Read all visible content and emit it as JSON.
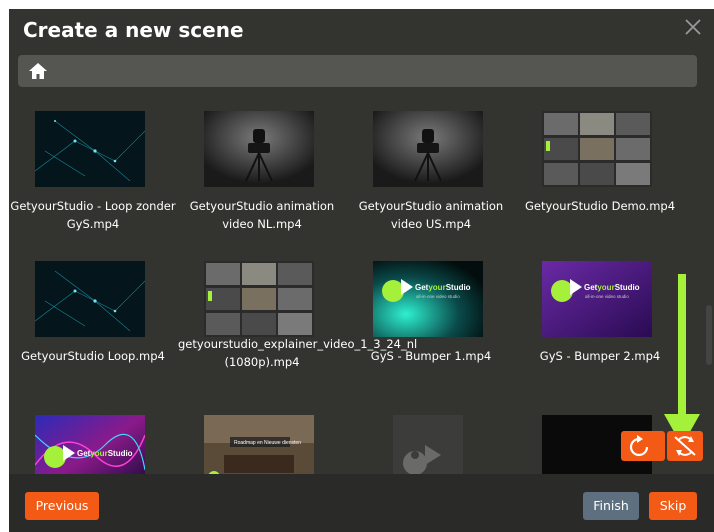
{
  "dialog": {
    "title": "Create a new scene",
    "close_icon": "close-icon",
    "breadcrumb_icon": "home-icon"
  },
  "media": [
    {
      "caption": "GetyourStudio - Loop zonder GyS.mp4",
      "thumb": "network"
    },
    {
      "caption": "GetyourStudio animation video NL.mp4",
      "thumb": "camera"
    },
    {
      "caption": "GetyourStudio animation video US.mp4",
      "thumb": "camera"
    },
    {
      "caption": "GetyourStudio Demo.mp4",
      "thumb": "collage"
    },
    {
      "caption": "GetyourStudio Loop.mp4",
      "thumb": "network"
    },
    {
      "caption": "getyourstudio_explainer_video_1_3_24_nl (1080p).mp4",
      "thumb": "collage"
    },
    {
      "caption": "GyS - Bumper 1.mp4",
      "thumb": "bumper-green"
    },
    {
      "caption": "GyS - Bumper 2.mp4",
      "thumb": "bumper-purple"
    },
    {
      "caption": "",
      "thumb": "bumper-neon"
    },
    {
      "caption": "",
      "thumb": "presentation"
    },
    {
      "caption": "",
      "thumb": "logo-grey"
    },
    {
      "caption": "",
      "thumb": "black"
    }
  ],
  "thumb_text": {
    "brand_a": "Get",
    "brand_b": "your",
    "brand_c": "Studio",
    "tagline": "all-in-one video studio",
    "roadmap": "Roadmap en Nieuwe diensten"
  },
  "controls": {
    "sync_icon": "sync-icon",
    "sync_disabled_icon": "sync-disabled-icon",
    "annotation": "arrow-down-icon"
  },
  "footer": {
    "previous": "Previous",
    "finish": "Finish",
    "skip": "Skip"
  },
  "colors": {
    "accent": "#f25a15",
    "finish": "#5e6f7f",
    "background": "#333330",
    "arrow": "#a4f03a"
  }
}
